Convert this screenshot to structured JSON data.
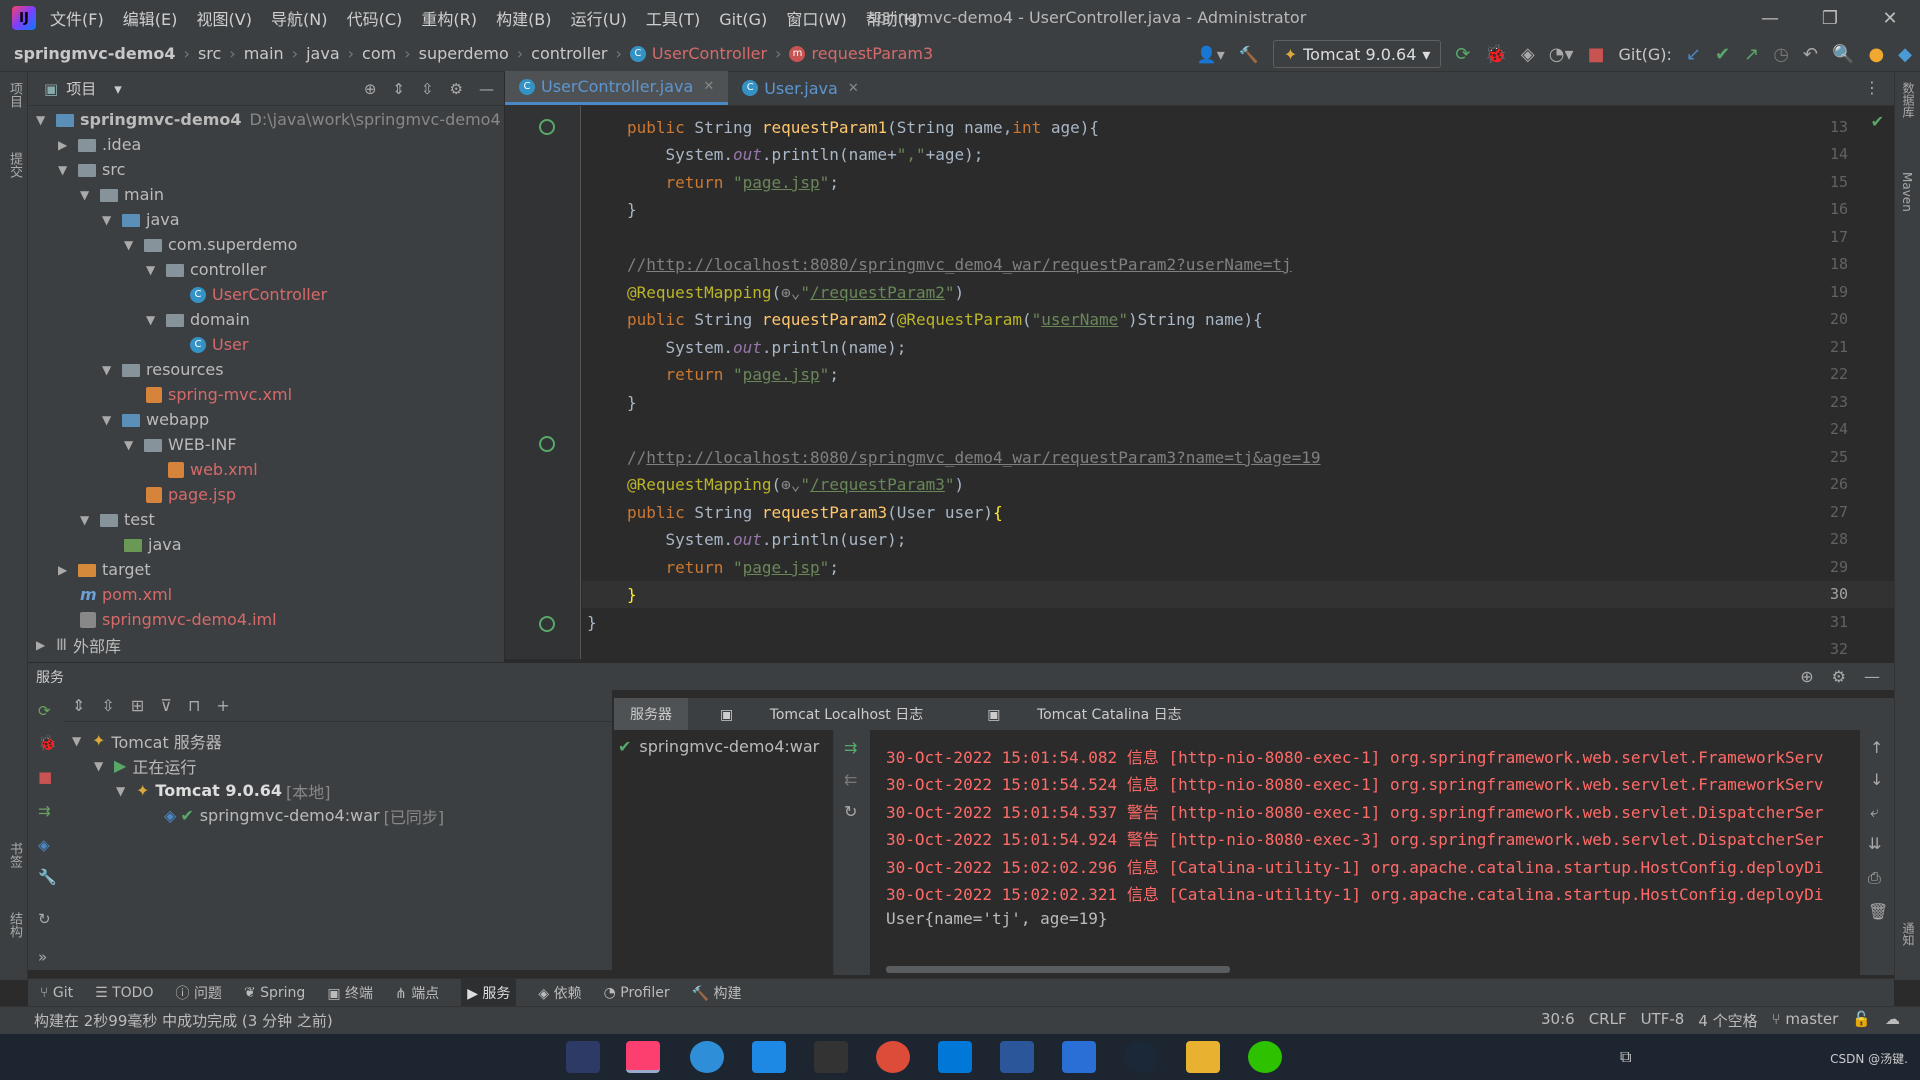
{
  "window": {
    "title": "springmvc-demo4 - UserController.java - Administrator",
    "menu": [
      "文件(F)",
      "编辑(E)",
      "视图(V)",
      "导航(N)",
      "代码(C)",
      "重构(R)",
      "构建(B)",
      "运行(U)",
      "工具(T)",
      "Git(G)",
      "窗口(W)",
      "帮助(H)"
    ]
  },
  "breadcrumb": {
    "items": [
      "springmvc-demo4",
      "src",
      "main",
      "java",
      "com",
      "superdemo",
      "controller"
    ],
    "class_name": "UserController",
    "method_name": "requestParam3"
  },
  "toolbar": {
    "run_config": "Tomcat 9.0.64",
    "git_label": "Git(G):"
  },
  "project_panel": {
    "title": "项目",
    "root_name": "springmvc-demo4",
    "root_path": "D:\\java\\work\\springmvc-demo4",
    "nodes": [
      ".idea",
      "src",
      "main",
      "java",
      "com.superdemo",
      "controller",
      "UserController",
      "domain",
      "User",
      "resources",
      "spring-mvc.xml",
      "webapp",
      "WEB-INF",
      "web.xml",
      "page.jsp",
      "test",
      "java",
      "target",
      "pom.xml",
      "springmvc-demo4.iml",
      "外部库"
    ]
  },
  "editor": {
    "tabs": [
      {
        "label": "UserController.java",
        "active": true
      },
      {
        "label": "User.java",
        "active": false
      }
    ],
    "line_numbers": [
      "13",
      "14",
      "15",
      "16",
      "17",
      "18",
      "19",
      "20",
      "21",
      "22",
      "23",
      "24",
      "25",
      "26",
      "27",
      "28",
      "29",
      "30",
      "31",
      "32"
    ],
    "comment_url_2": "http://localhost:8080/springmvc_demo4_war/requestParam2?userName=tj",
    "comment_url_3": "http://localhost:8080/springmvc_demo4_war/requestParam3?name=tj&age=19",
    "mapping_2": "/requestParam2",
    "mapping_3": "/requestParam3",
    "param_name": "userName",
    "return_value": "page.jsp"
  },
  "services": {
    "title": "服务",
    "tree": {
      "group": "Tomcat 服务器",
      "state": "正在运行",
      "server": "Tomcat 9.0.64",
      "server_tag": "[本地]",
      "artifact": "springmvc-demo4:war",
      "artifact_tag": "[已同步]"
    },
    "log_tabs": [
      "服务器",
      "Tomcat Localhost 日志",
      "Tomcat Catalina 日志"
    ],
    "deployment": "springmvc-demo4:war",
    "log_lines": [
      "30-Oct-2022 15:01:54.082 信息 [http-nio-8080-exec-1] org.springframework.web.servlet.FrameworkServ",
      "30-Oct-2022 15:01:54.524 信息 [http-nio-8080-exec-1] org.springframework.web.servlet.FrameworkServ",
      "30-Oct-2022 15:01:54.537 警告 [http-nio-8080-exec-1] org.springframework.web.servlet.DispatcherSer",
      "30-Oct-2022 15:01:54.924 警告 [http-nio-8080-exec-3] org.springframework.web.servlet.DispatcherSer",
      "30-Oct-2022 15:02:02.296 信息 [Catalina-utility-1] org.apache.catalina.startup.HostConfig.deployDi",
      "30-Oct-2022 15:02:02.321 信息 [Catalina-utility-1] org.apache.catalina.startup.HostConfig.deployDi"
    ],
    "output_line": "User{name='tj', age=19}"
  },
  "bottom_tabs": [
    "Git",
    "TODO",
    "问题",
    "Spring",
    "终端",
    "端点",
    "服务",
    "依赖",
    "Profiler",
    "构建"
  ],
  "status": {
    "message": "构建在 2秒99毫秒 中成功完成 (3 分钟 之前)",
    "position": "30:6",
    "line_sep": "CRLF",
    "encoding": "UTF-8",
    "indent": "4 个空格",
    "branch": "master"
  },
  "side_labels": {
    "left_top": "项目",
    "left_mid": "提交",
    "left_bm": "书签",
    "left_struct": "结构",
    "right_db": "数据库",
    "right_maven": "Maven",
    "right_notify": "通知"
  },
  "taskbar": {
    "credit": "CSDN @汤键."
  },
  "colors": {
    "accent": "#4a88c7",
    "selection": "#0d293e",
    "error_log": "#ff6b68"
  }
}
